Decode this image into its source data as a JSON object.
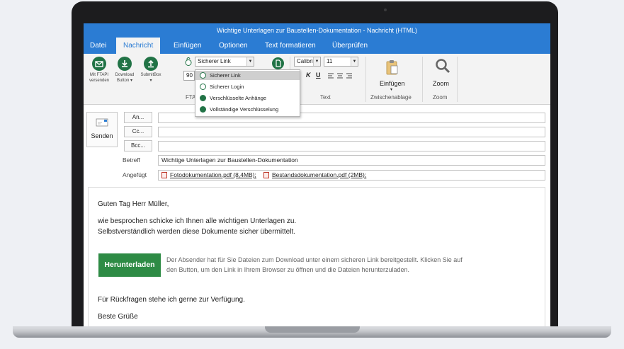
{
  "window": {
    "title": "Wichtige Unterlagen zur Baustellen-Dokumentation - Nachricht (HTML)"
  },
  "tabs": [
    "Datei",
    "Nachricht",
    "Einfügen",
    "Optionen",
    "Text formatieren",
    "Überprüfen"
  ],
  "active_tab": "Nachricht",
  "ribbon": {
    "mit_ftapi_1": "Mit FTAPI",
    "mit_ftapi_2": "versenden",
    "download_1": "Download",
    "download_2": "Button ▾",
    "submitbox": "SubmitBox",
    "submitbox_arrow": "▾",
    "link_type_value": "Sicherer Link",
    "days_value": "90",
    "ftapi_group": "FTAPI",
    "font_value": "Calibri",
    "size_value": "11",
    "format_italic": "K",
    "format_underline": "U",
    "text_group": "Text",
    "paste_label": "Einfügen",
    "paste_arrow": "▾",
    "clipboard_group": "Zwischenablage",
    "zoom_label": "Zoom",
    "zoom_group": "Zoom"
  },
  "dropdown": {
    "items": [
      "Sicherer Link",
      "Sicherer Login",
      "Verschlüsselte Anhänge",
      "Vollständige Verschlüsselung"
    ],
    "selected": "Sicherer Link"
  },
  "compose": {
    "send_label": "Senden",
    "to_button": "An...",
    "cc_button": "Cc...",
    "bcc_button": "Bcc...",
    "to_value": "",
    "cc_value": "",
    "bcc_value": "",
    "subject_label": "Betreff",
    "subject_value": "Wichtige Unterlagen zur Baustellen-Dokumentation",
    "attached_label": "Angefügt",
    "attachments": [
      "Fotodokumentation.pdf (8,4MB);",
      "Bestandsdokumentation.pdf (2MB);"
    ]
  },
  "message": {
    "greeting": "Guten Tag Herr Müller,",
    "line1": "wie besprochen schicke ich Ihnen alle wichtigen Unterlagen zu.",
    "line2": "Selbstverständlich werden diese Dokumente sicher übermittelt.",
    "download_button": "Herunterladen",
    "download_note": "Der Absender hat für Sie Dateien zum Download unter einem sicheren Link bereitgestellt. Klicken Sie auf den Button, um den Link in Ihrem Browser zu öffnen und die Dateien herunterzuladen.",
    "closing": "Für Rückfragen stehe ich gerne zur Verfügung.",
    "signoff_partial": "Beste Grüße"
  },
  "colors": {
    "accent": "#2b7cd3",
    "ftapi_green": "#217346",
    "download_green": "#2e8b45"
  }
}
